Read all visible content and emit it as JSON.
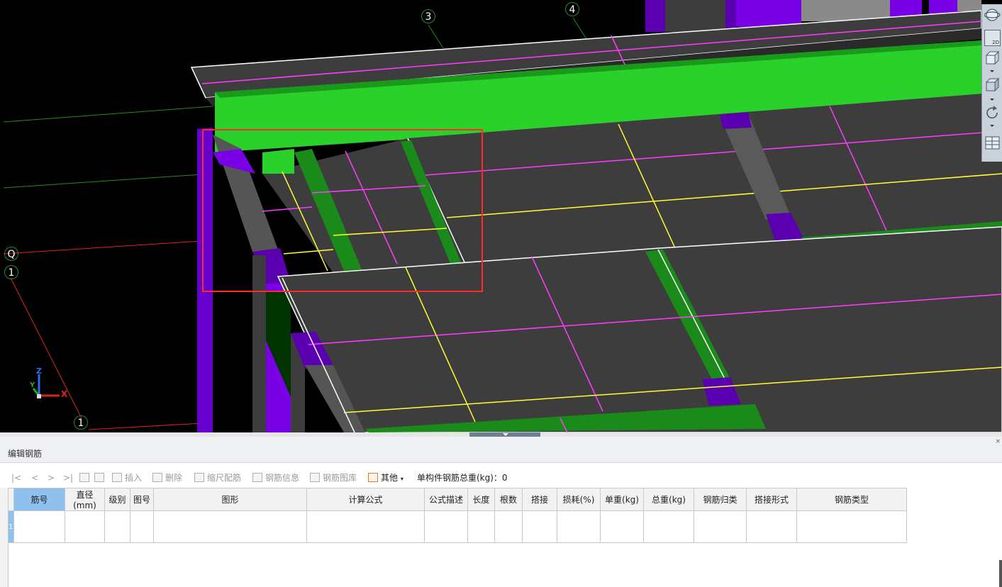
{
  "viewport": {
    "axis_labels": {
      "col_3": "3",
      "col_4": "4",
      "row_q": "Q",
      "row_1_left": "1",
      "row_1_bottom": "1"
    },
    "triad": {
      "z": "Z",
      "y": "Y",
      "x": "X"
    },
    "colors": {
      "background": "#000000",
      "slab": "#3d3d3d",
      "beam_green": "#2ad12a",
      "beam_dark_green": "#1a8a1a",
      "column_purple": "#7a00e6",
      "rebar_magenta": "#ff3cff",
      "rebar_yellow": "#ffff33",
      "grid_line_green": "#1f8f1f",
      "grid_line_red": "#e02020",
      "selection_box": "#ff2a2a"
    },
    "view_toolbar": {
      "items": [
        "orbit-icon",
        "2d-view-icon",
        "3d-box-icon",
        "solid-box-icon",
        "rotate-icon",
        "layout-icon"
      ],
      "view_2d_label": "2D"
    }
  },
  "panel": {
    "title": "编辑钢筋",
    "close_label": "×",
    "toolbar": {
      "nav_first": "|<",
      "nav_prev": "<",
      "nav_next": ">",
      "nav_last": ">|",
      "insert": "插入",
      "delete": "删除",
      "scale_rebar": "缩尺配筋",
      "rebar_info": "钢筋信息",
      "rebar_library": "钢筋图库",
      "other": "其他",
      "total_weight_label": "单构件钢筋总重(kg)：0"
    },
    "table": {
      "columns": [
        "筋号",
        "直径(mm)",
        "级别",
        "图号",
        "图形",
        "计算公式",
        "公式描述",
        "长度",
        "根数",
        "搭接",
        "损耗(%)",
        "单重(kg)",
        "总重(kg)",
        "钢筋归类",
        "搭接形式",
        "钢筋类型"
      ],
      "rows": [
        {
          "row_number": "1",
          "cells": [
            "",
            "",
            "",
            "",
            "",
            "",
            "",
            "",
            "",
            "",
            "",
            "",
            "",
            "",
            "",
            ""
          ]
        }
      ]
    }
  }
}
